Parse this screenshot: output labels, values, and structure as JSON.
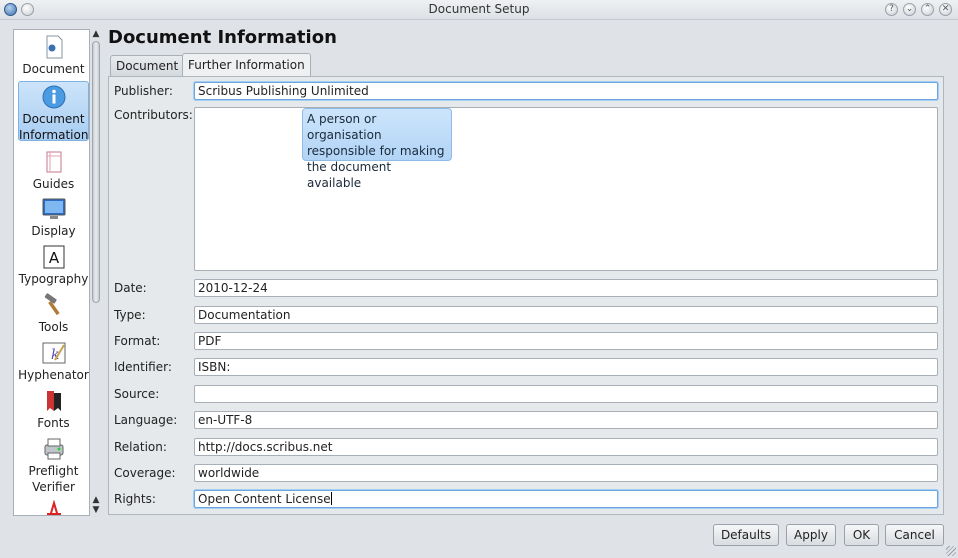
{
  "window": {
    "title": "Document Setup"
  },
  "sidebar": {
    "items": [
      {
        "label": "Document",
        "icon": "document-icon"
      },
      {
        "label": "Document Information",
        "icon": "info-icon"
      },
      {
        "label": "Guides",
        "icon": "guides-icon"
      },
      {
        "label": "Display",
        "icon": "display-icon"
      },
      {
        "label": "Typography",
        "icon": "typography-icon"
      },
      {
        "label": "Tools",
        "icon": "tools-icon"
      },
      {
        "label": "Hyphenator",
        "icon": "hyphenator-icon"
      },
      {
        "label": "Fonts",
        "icon": "fonts-icon"
      },
      {
        "label": "Preflight Verifier",
        "icon": "preflight-icon"
      }
    ],
    "active_index": 1
  },
  "page": {
    "heading": "Document Information"
  },
  "tabs": [
    {
      "label": "Document"
    },
    {
      "label": "Further Information"
    }
  ],
  "form": {
    "publisher": {
      "label": "Publisher:",
      "value": "Scribus Publishing Unlimited"
    },
    "contributors": {
      "label": "Contributors:",
      "value": ""
    },
    "date": {
      "label": "Date:",
      "value": "2010-12-24"
    },
    "type": {
      "label": "Type:",
      "value": "Documentation"
    },
    "format": {
      "label": "Format:",
      "value": "PDF"
    },
    "identifier": {
      "label": "Identifier:",
      "value": "ISBN:"
    },
    "source": {
      "label": "Source:",
      "value": ""
    },
    "language": {
      "label": "Language:",
      "value": "en-UTF-8"
    },
    "relation": {
      "label": "Relation:",
      "value": "http://docs.scribus.net"
    },
    "coverage": {
      "label": "Coverage:",
      "value": "worldwide"
    },
    "rights": {
      "label": "Rights:",
      "value": "Open Content License"
    }
  },
  "tooltip": {
    "text": "A person or organisation responsible for making the document available"
  },
  "buttons": {
    "defaults": "Defaults",
    "apply": "Apply",
    "ok": "OK",
    "cancel": "Cancel"
  },
  "colors": {
    "accent": "#a8cdf2",
    "tooltip": "#b2d4f6"
  }
}
